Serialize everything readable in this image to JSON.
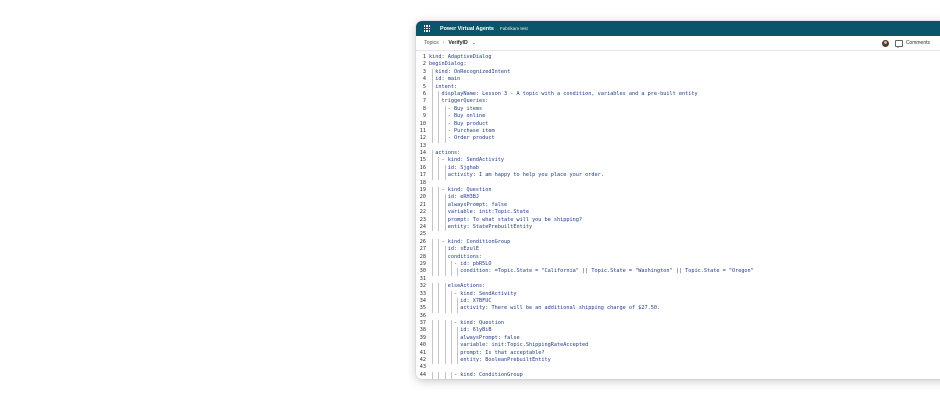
{
  "app": {
    "title": "Power Virtual Agents",
    "tenant": "Fabrikam test"
  },
  "breadcrumb": {
    "topics": "Topics",
    "current": "VerifyID"
  },
  "toolbar": {
    "comments_label": "Comments"
  },
  "code_lines": [
    "kind: AdaptiveDialog",
    "beginDialog:",
    "  kind: OnRecognizedIntent",
    "  id: main",
    "  intent:",
    "    displayName: Lesson 3 - A topic with a condition, variables and a pre-built entity",
    "    triggerQueries:",
    "      - Buy items",
    "      - Buy online",
    "      - Buy product",
    "      - Purchase item",
    "      - Order product",
    "",
    "  actions:",
    "    - kind: SendActivity",
    "      id: Sjghab",
    "      activity: I am happy to help you place your order.",
    "",
    "    - kind: Question",
    "      id: eRH3BJ",
    "      alwaysPrompt: false",
    "      variable: init:Topic.State",
    "      prompt: To what state will you be shipping?",
    "      entity: StatePrebuiltEntity",
    "",
    "    - kind: ConditionGroup",
    "      id: sEzulE",
    "      conditions:",
    "        - id: pbR5LO",
    "          condition: =Topic.State = \"California\" || Topic.State = \"Washington\" || Topic.State = \"Oregon\"",
    "",
    "      elseActions:",
    "        - kind: SendActivity",
    "          id: X7BFUC",
    "          activity: There will be an additional shipping charge of $27.50.",
    "",
    "        - kind: Question",
    "          id: 6lyBiB",
    "          alwaysPrompt: false",
    "          variable: init:Topic.ShippingRateAccepted",
    "          prompt: Is that acceptable?",
    "          entity: BooleanPrebuiltEntity",
    "",
    "        - kind: ConditionGroup",
    "          id: WS0ZVP"
  ]
}
